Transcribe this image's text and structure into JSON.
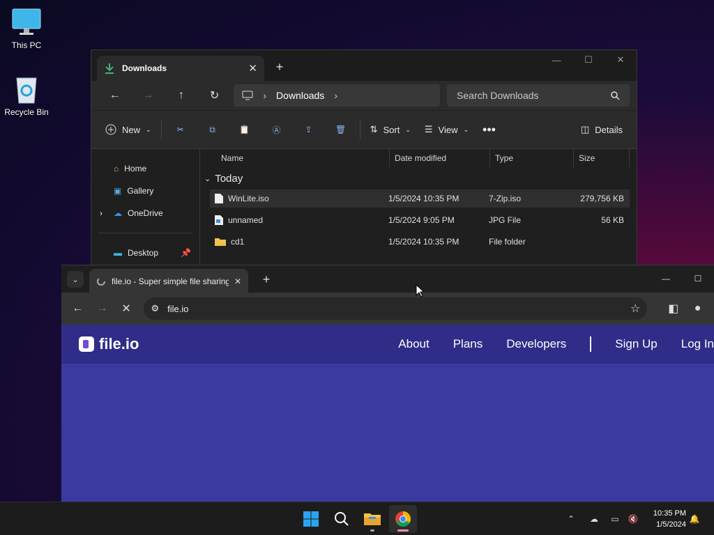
{
  "desktop": {
    "icons": [
      {
        "label": "This PC"
      },
      {
        "label": "Recycle Bin"
      }
    ]
  },
  "explorer": {
    "tab_title": "Downloads",
    "breadcrumb": [
      "Downloads"
    ],
    "search_placeholder": "Search Downloads",
    "commands": {
      "new": "New",
      "sort": "Sort",
      "view": "View",
      "details": "Details"
    },
    "sidebar": [
      {
        "label": "Home"
      },
      {
        "label": "Gallery"
      },
      {
        "label": "OneDrive"
      },
      {
        "label": "Desktop"
      }
    ],
    "columns": {
      "name": "Name",
      "date": "Date modified",
      "type": "Type",
      "size": "Size"
    },
    "group": "Today",
    "files": [
      {
        "name": "WinLite.iso",
        "date": "1/5/2024 10:35 PM",
        "type": "7-Zip.iso",
        "size": "279,756 KB",
        "icon": "iso-file-icon"
      },
      {
        "name": "unnamed",
        "date": "1/5/2024 9:05 PM",
        "type": "JPG File",
        "size": "56 KB",
        "icon": "image-file-icon"
      },
      {
        "name": "cd1",
        "date": "1/5/2024 10:35 PM",
        "type": "File folder",
        "size": "",
        "icon": "folder-icon"
      }
    ]
  },
  "chrome": {
    "tab_title": "file.io - Super simple file sharing",
    "url": "file.io",
    "site": {
      "logo_text": "file.io",
      "nav": [
        "About",
        "Plans",
        "Developers",
        "Sign Up",
        "Log In"
      ],
      "brand_color": "#3a3aa0"
    }
  },
  "taskbar": {
    "time": "10:35 PM",
    "date": "1/5/2024"
  }
}
